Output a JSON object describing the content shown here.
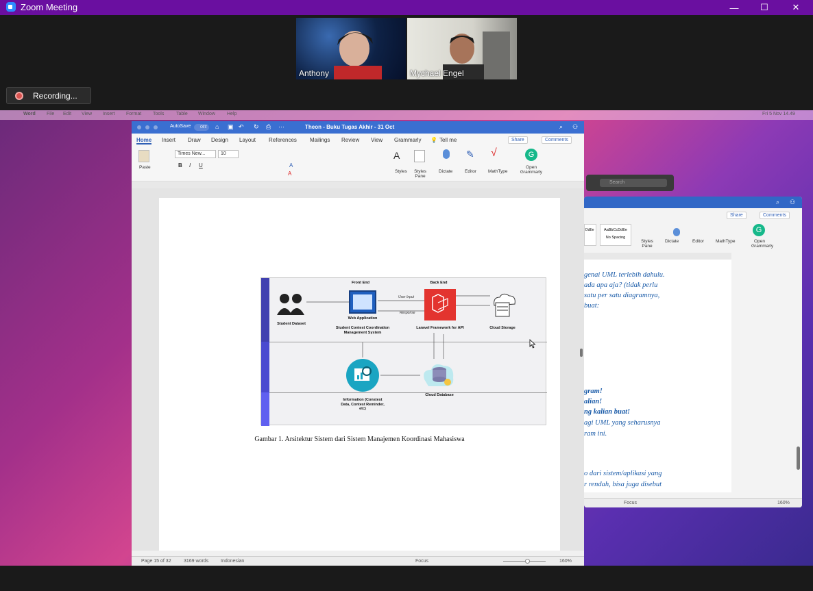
{
  "zoom": {
    "title": "Zoom Meeting",
    "recording_label": "Recording..."
  },
  "participants": [
    {
      "name": "Anthony"
    },
    {
      "name": "Mychael Engel"
    }
  ],
  "mac_menu": {
    "items": [
      "Word",
      "File",
      "Edit",
      "View",
      "Insert",
      "Format",
      "Tools",
      "Table",
      "Window",
      "Help"
    ],
    "clock": "Fri 5 Nov  14.49"
  },
  "word_front": {
    "autosave": "AutoSave",
    "autosave_state": "OFF",
    "doc_title": "Theon - Buku Tugas Akhir - 31 Oct",
    "tell_me": "Tell me",
    "tabs": [
      "Home",
      "Insert",
      "Draw",
      "Design",
      "Layout",
      "References",
      "Mailings",
      "Review",
      "View",
      "Grammarly"
    ],
    "share": "Share",
    "comments": "Comments",
    "font_name": "Times New...",
    "font_size": "10",
    "ribbon": {
      "paste": "Paste",
      "styles": "Styles",
      "styles_pane": "Styles Pane",
      "dictate": "Dictate",
      "editor": "Editor",
      "mathtype": "MathType",
      "open_grammarly": "Open Grammarly"
    },
    "status": {
      "page": "Page 15 of 32",
      "words": "3169 words",
      "language": "Indonesian",
      "focus": "Focus",
      "zoom": "160%"
    }
  },
  "diagram": {
    "front_end": "Front End",
    "back_end": "Back End",
    "student_dataset": "Student Dataset",
    "web_application": "Web Application",
    "scms": "Student Contest Coordination Management System",
    "user_input": "User Input",
    "response": "Response",
    "laravel": "Laravel Framework for API",
    "cloud_storage": "Cloud Storage",
    "information": "Information (Constest Data, Contest Reminder, etc)",
    "cloud_database": "Cloud Database"
  },
  "caption": "Gambar 1. Arsitektur Sistem dari Sistem Manajemen Koordinasi Mahasiswa",
  "word_back": {
    "search": "Search",
    "share": "Share",
    "comments": "Comments",
    "style1": "AaBbCcDdEe",
    "style1_name": "No Spacing",
    "style0": "DdEe",
    "styles_pane": "Styles Pane",
    "dictate": "Dictate",
    "editor": "Editor",
    "mathtype": "MathType",
    "open_grammarly": "Open Grammarly",
    "lines_italic": [
      "genai UML terlebih dahulu.",
      "ada apa aja? (tidak perlu",
      "satu per satu diagramnya,",
      "buat:"
    ],
    "lines_bold": [
      "gram!",
      "alian!",
      "ng kalian buat!"
    ],
    "lines_italic2": [
      "agi UML yang seharusnya",
      "ram ini."
    ],
    "lines_italic3": [
      "o dari sistem/aplikasi yang",
      "r rendah, bisa juga disebut"
    ],
    "focus": "Focus",
    "zoom": "160%"
  }
}
